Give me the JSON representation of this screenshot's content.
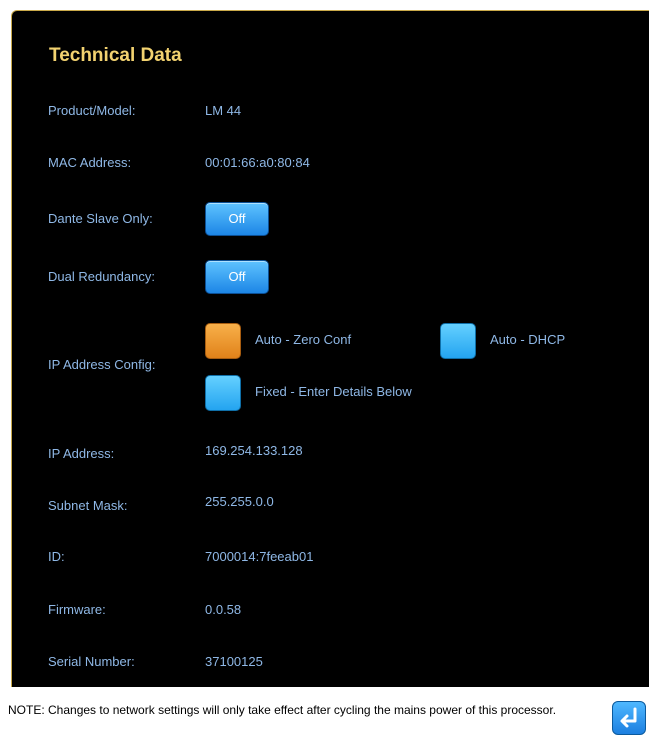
{
  "title": "Technical Data",
  "rows": {
    "product": {
      "label": "Product/Model:",
      "value": "LM 44"
    },
    "mac": {
      "label": "MAC Address:",
      "value": "00:01:66:a0:80:84"
    },
    "dante": {
      "label": "Dante Slave Only:",
      "button": "Off"
    },
    "dual": {
      "label": "Dual Redundancy:",
      "button": "Off"
    },
    "ipconfig": {
      "label": "IP Address Config:",
      "options": [
        {
          "label": "Auto - Zero Conf",
          "selected": true
        },
        {
          "label": "Auto - DHCP",
          "selected": false
        },
        {
          "label": "Fixed - Enter Details Below",
          "selected": false
        }
      ]
    },
    "ip": {
      "label": "IP Address:",
      "value": "169.254.133.128"
    },
    "subnet": {
      "label": "Subnet Mask:",
      "value": "255.255.0.0"
    },
    "id": {
      "label": "ID:",
      "value": "7000014:7feeab01"
    },
    "firmware": {
      "label": "Firmware:",
      "value": "0.0.58"
    },
    "serial": {
      "label": "Serial Number:",
      "value": "37100125"
    }
  },
  "note": "NOTE: Changes to network settings will only take effect after cycling the mains power of this processor.",
  "colors": {
    "title": "#f2d270",
    "text": "#8fb8e6",
    "selected": "#f0a030",
    "button": "#2aa0f0"
  },
  "icons": {
    "return": "return-arrow-icon"
  }
}
